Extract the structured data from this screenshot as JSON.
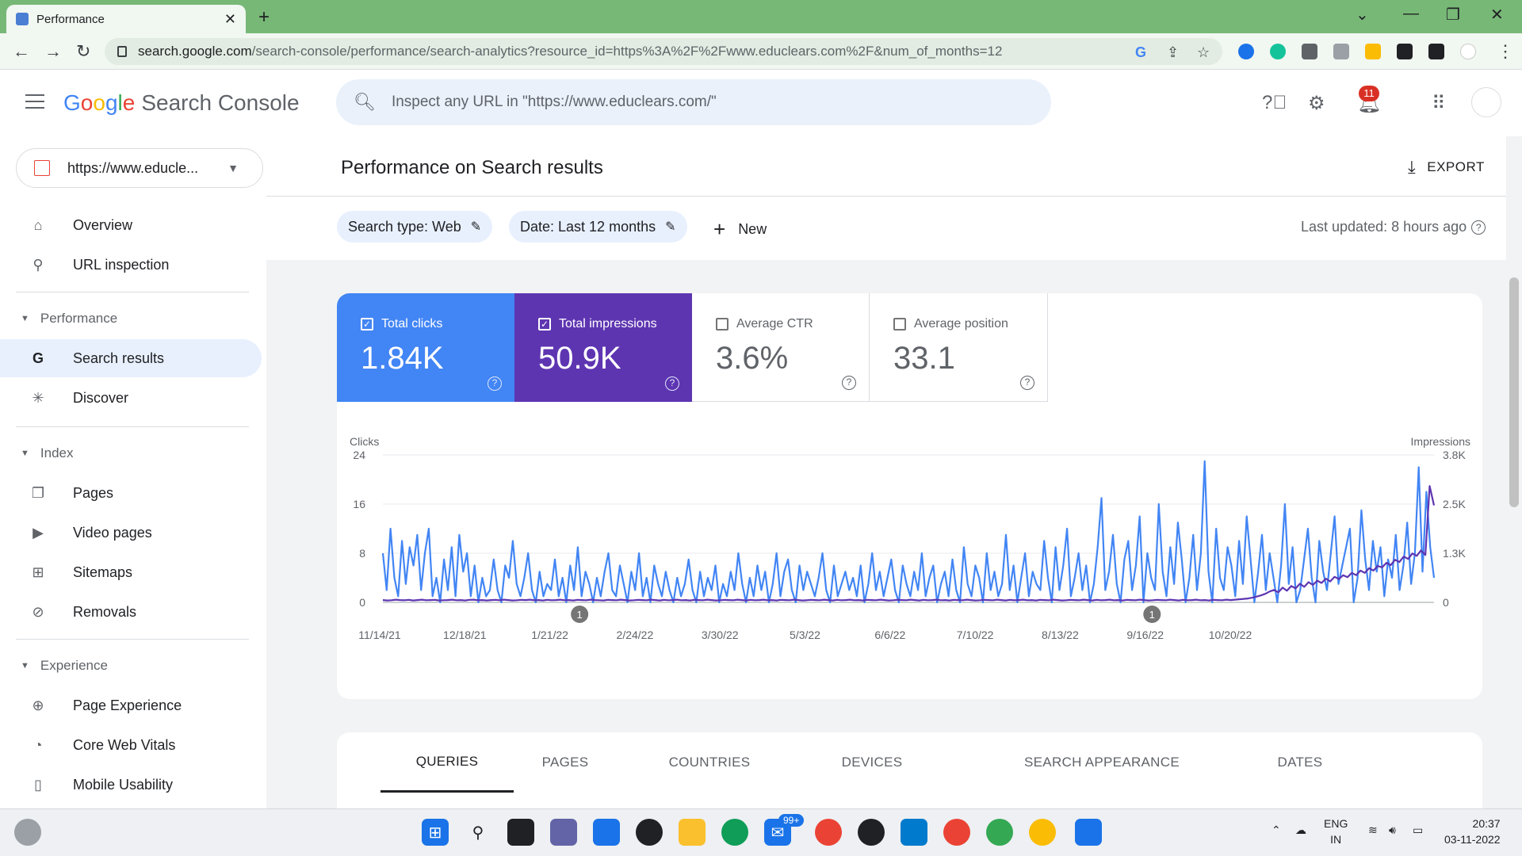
{
  "browser": {
    "tab_title": "Performance",
    "url_host": "search.google.com",
    "url_path": "/search-console/performance/search-analytics?resource_id=https%3A%2F%2Fwww.educlears.com%2F&num_of_months=12"
  },
  "header": {
    "logo_google": [
      "G",
      "o",
      "o",
      "g",
      "l",
      "e"
    ],
    "product": "Search Console",
    "search_placeholder": "Inspect any URL in \"https://www.educlears.com/\"",
    "notifications_count": "11"
  },
  "sidebar": {
    "property": "https://www.educle...",
    "items_top": [
      {
        "label": "Overview",
        "icon": "home-icon"
      },
      {
        "label": "URL inspection",
        "icon": "search-icon"
      }
    ],
    "performance_title": "Performance",
    "performance_items": [
      {
        "label": "Search results",
        "icon": "google-g-icon"
      },
      {
        "label": "Discover",
        "icon": "asterisk-icon"
      }
    ],
    "index_title": "Index",
    "index_items": [
      {
        "label": "Pages",
        "icon": "pages-icon"
      },
      {
        "label": "Video pages",
        "icon": "video-icon"
      },
      {
        "label": "Sitemaps",
        "icon": "sitemap-icon"
      },
      {
        "label": "Removals",
        "icon": "eye-off-icon"
      }
    ],
    "experience_title": "Experience",
    "experience_items": [
      {
        "label": "Page Experience",
        "icon": "plus-circle-icon"
      },
      {
        "label": "Core Web Vitals",
        "icon": "gauge-icon"
      },
      {
        "label": "Mobile Usability",
        "icon": "phone-icon"
      }
    ]
  },
  "main": {
    "title": "Performance on Search results",
    "export_label": "EXPORT",
    "chip_search_type": "Search type: Web",
    "chip_date": "Date: Last 12 months",
    "new_label": "New",
    "last_updated": "Last updated: 8 hours ago",
    "metrics": {
      "clicks": {
        "label": "Total clicks",
        "value": "1.84K",
        "checked": true
      },
      "impressions": {
        "label": "Total impressions",
        "value": "50.9K",
        "checked": true
      },
      "ctr": {
        "label": "Average CTR",
        "value": "3.6%",
        "checked": false
      },
      "position": {
        "label": "Average position",
        "value": "33.1",
        "checked": false
      }
    },
    "tabs": [
      "QUERIES",
      "PAGES",
      "COUNTRIES",
      "DEVICES",
      "SEARCH APPEARANCE",
      "DATES"
    ],
    "active_tab": "QUERIES"
  },
  "chart_data": {
    "type": "line",
    "left_axis_label": "Clicks",
    "right_axis_label": "Impressions",
    "left_ticks": [
      "24",
      "16",
      "8",
      "0"
    ],
    "right_ticks": [
      "3.8K",
      "2.5K",
      "1.3K",
      "0"
    ],
    "ylim_clicks": [
      0,
      24
    ],
    "ylim_impressions": [
      0,
      3800
    ],
    "x_tick_labels": [
      "11/14/21",
      "12/18/21",
      "1/21/22",
      "2/24/22",
      "3/30/22",
      "5/3/22",
      "6/6/22",
      "7/10/22",
      "8/13/22",
      "9/16/22",
      "10/20/22"
    ],
    "annotations": [
      {
        "label": "1",
        "x_tick_index": 2.35
      },
      {
        "label": "1",
        "x_tick_index": 9.08
      }
    ],
    "colors": {
      "clicks": "#4285f4",
      "impressions": "#5e35b1"
    },
    "series": [
      {
        "name": "Clicks",
        "axis": "left",
        "values": [
          8,
          2,
          12,
          4,
          1,
          10,
          3,
          9,
          6,
          11,
          2,
          8,
          12,
          1,
          4,
          0,
          7,
          2,
          9,
          1,
          11,
          5,
          8,
          1,
          6,
          0,
          4,
          1,
          2,
          7,
          2,
          0,
          6,
          4,
          10,
          3,
          1,
          4,
          8,
          2,
          0,
          5,
          1,
          3,
          2,
          7,
          1,
          4,
          0,
          6,
          2,
          9,
          1,
          5,
          3,
          0,
          4,
          1,
          5,
          8,
          2,
          1,
          6,
          3,
          0,
          5,
          2,
          8,
          1,
          4,
          0,
          6,
          3,
          1,
          5,
          2,
          0,
          4,
          1,
          3,
          7,
          2,
          0,
          5,
          1,
          4,
          2,
          6,
          0,
          3,
          1,
          5,
          2,
          8,
          3,
          0,
          4,
          1,
          6,
          2,
          5,
          0,
          3,
          8,
          1,
          5,
          7,
          2,
          0,
          6,
          2,
          5,
          3,
          1,
          4,
          8,
          2,
          0,
          6,
          1,
          3,
          5,
          2,
          4,
          1,
          6,
          0,
          3,
          8,
          2,
          5,
          1,
          4,
          7,
          2,
          0,
          6,
          3,
          1,
          5,
          2,
          8,
          1,
          4,
          6,
          0,
          3,
          5,
          1,
          7,
          2,
          0,
          9,
          3,
          1,
          6,
          4,
          0,
          8,
          2,
          5,
          1,
          3,
          11,
          2,
          6,
          0,
          4,
          8,
          1,
          5,
          3,
          2,
          10,
          4,
          0,
          9,
          2,
          6,
          12,
          1,
          4,
          8,
          2,
          6,
          0,
          3,
          9,
          17,
          2,
          5,
          11,
          3,
          0,
          7,
          10,
          2,
          6,
          14,
          0,
          8,
          4,
          2,
          16,
          5,
          1,
          9,
          3,
          13,
          7,
          0,
          4,
          11,
          2,
          8,
          23,
          5,
          0,
          12,
          4,
          2,
          9,
          6,
          1,
          10,
          3,
          14,
          7,
          0,
          5,
          11,
          2,
          8,
          4,
          0,
          6,
          16,
          3,
          9,
          0,
          2,
          7,
          12,
          4,
          0,
          10,
          5,
          2,
          8,
          14,
          3,
          6,
          9,
          12,
          0,
          4,
          15,
          7,
          2,
          10,
          5,
          9,
          1,
          7,
          4,
          11,
          2,
          6,
          13,
          3,
          8,
          22,
          5,
          18,
          9,
          4
        ]
      },
      {
        "name": "Impressions",
        "axis": "right",
        "values": [
          60,
          50,
          55,
          70,
          60,
          55,
          65,
          50,
          60,
          70,
          55,
          60,
          65,
          50,
          55,
          60,
          70,
          55,
          60,
          50,
          65,
          70,
          55,
          60,
          50,
          60,
          65,
          55,
          70,
          60,
          50,
          55,
          65,
          60,
          70,
          55,
          60,
          50,
          65,
          55,
          60,
          70,
          55,
          60,
          50,
          65,
          60,
          55,
          70,
          60,
          55,
          50,
          65,
          60,
          55,
          70,
          60,
          50,
          55,
          65,
          60,
          55,
          70,
          60,
          50,
          65,
          55,
          60,
          70,
          55,
          60,
          50,
          65,
          60,
          55,
          70,
          60,
          50,
          55,
          65,
          60,
          55,
          70,
          60,
          50,
          65,
          55,
          60,
          70,
          55,
          60,
          50,
          65,
          60,
          55,
          70,
          60,
          50,
          55,
          65,
          60,
          55,
          70,
          60,
          50,
          65,
          55,
          60,
          70,
          55,
          60,
          50,
          65,
          60,
          55,
          70,
          60,
          50,
          55,
          65,
          60,
          55,
          70,
          60,
          50,
          65,
          55,
          60,
          70,
          55,
          60,
          50,
          65,
          60,
          55,
          70,
          60,
          50,
          55,
          65,
          60,
          55,
          70,
          60,
          50,
          65,
          55,
          60,
          70,
          55,
          60,
          50,
          65,
          60,
          55,
          70,
          60,
          50,
          55,
          65,
          60,
          55,
          70,
          60,
          50,
          65,
          55,
          60,
          70,
          55,
          60,
          50,
          65,
          60,
          55,
          70,
          60,
          50,
          55,
          65,
          60,
          55,
          70,
          60,
          50,
          65,
          55,
          60,
          70,
          55,
          60,
          50,
          65,
          60,
          55,
          70,
          60,
          70,
          80,
          90,
          100,
          120,
          150,
          180,
          220,
          280,
          320,
          260,
          380,
          300,
          420,
          360,
          480,
          400,
          520,
          450,
          560,
          500,
          610,
          540,
          660,
          600,
          700,
          650,
          760,
          700,
          820,
          760,
          880,
          820,
          940,
          900,
          1020,
          960,
          1100,
          1040,
          1180,
          1120,
          1260,
          1200,
          1340,
          1220,
          3000,
          2500
        ]
      }
    ]
  }
}
